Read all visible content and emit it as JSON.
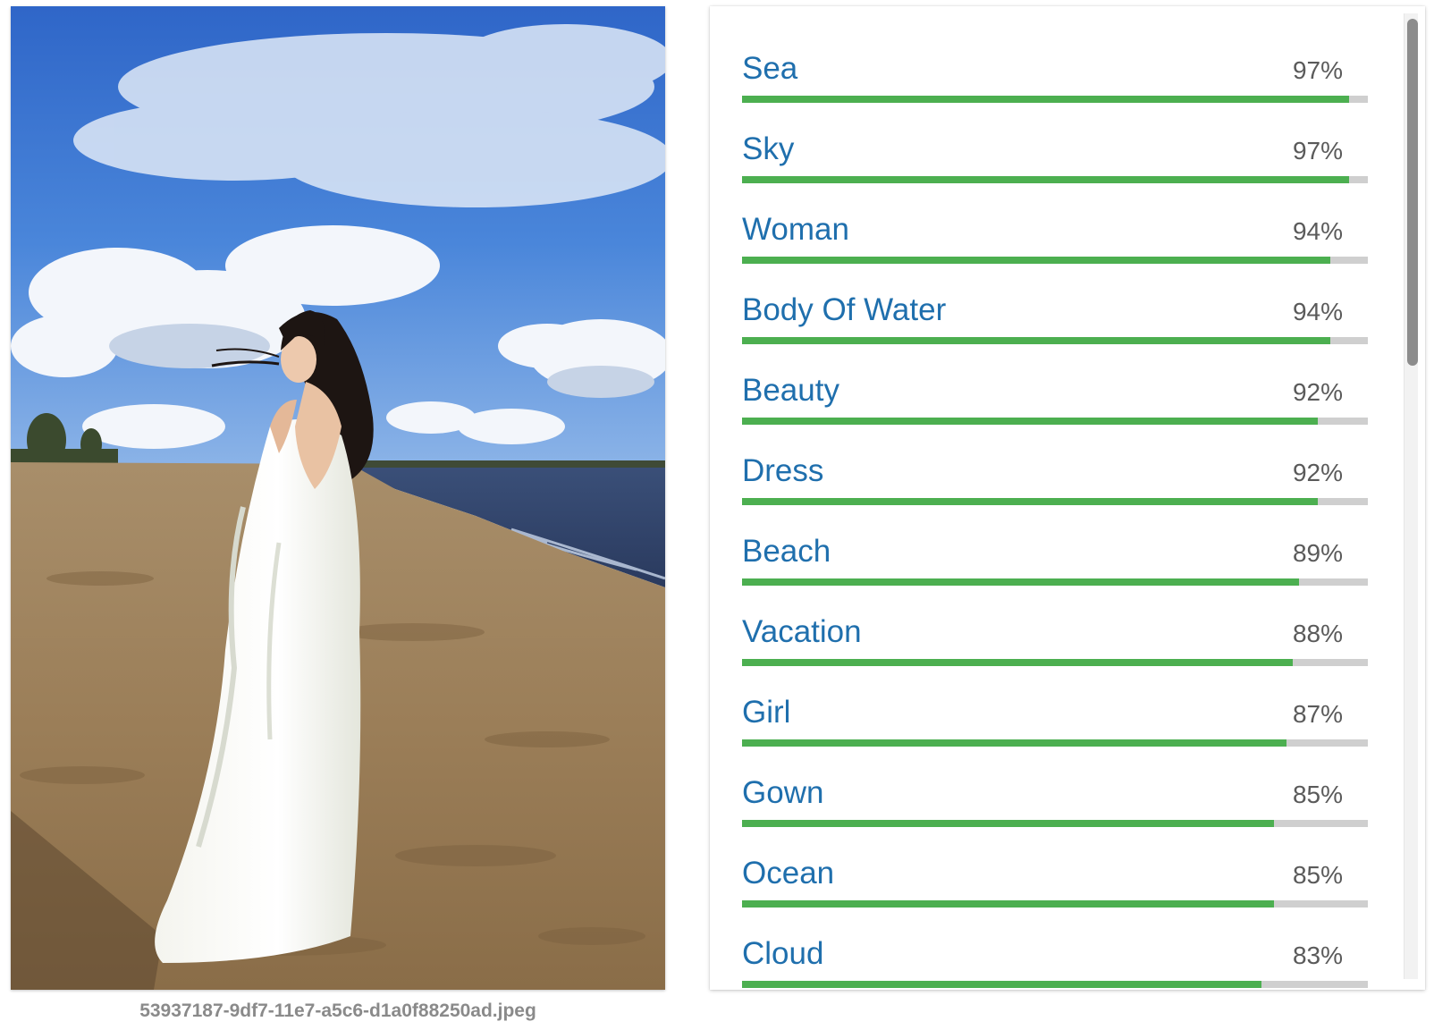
{
  "image": {
    "filename": "53937187-9df7-11e7-a5c6-d1a0f88250ad.jpeg",
    "alt": "Woman in white dress on a sandy beach by the sea under a cloudy blue sky"
  },
  "labels": [
    {
      "name": "Sea",
      "percent_text": "97%",
      "score": 0.97
    },
    {
      "name": "Sky",
      "percent_text": "97%",
      "score": 0.97
    },
    {
      "name": "Woman",
      "percent_text": "94%",
      "score": 0.94
    },
    {
      "name": "Body Of Water",
      "percent_text": "94%",
      "score": 0.94
    },
    {
      "name": "Beauty",
      "percent_text": "92%",
      "score": 0.92
    },
    {
      "name": "Dress",
      "percent_text": "92%",
      "score": 0.92
    },
    {
      "name": "Beach",
      "percent_text": "89%",
      "score": 0.89
    },
    {
      "name": "Vacation",
      "percent_text": "88%",
      "score": 0.88
    },
    {
      "name": "Girl",
      "percent_text": "87%",
      "score": 0.87
    },
    {
      "name": "Gown",
      "percent_text": "85%",
      "score": 0.85
    },
    {
      "name": "Ocean",
      "percent_text": "85%",
      "score": 0.85
    },
    {
      "name": "Cloud",
      "percent_text": "83%",
      "score": 0.83
    }
  ],
  "colors": {
    "label_text": "#1f6fad",
    "bar_fill": "#4caf50",
    "bar_track": "#cfcfcf"
  }
}
